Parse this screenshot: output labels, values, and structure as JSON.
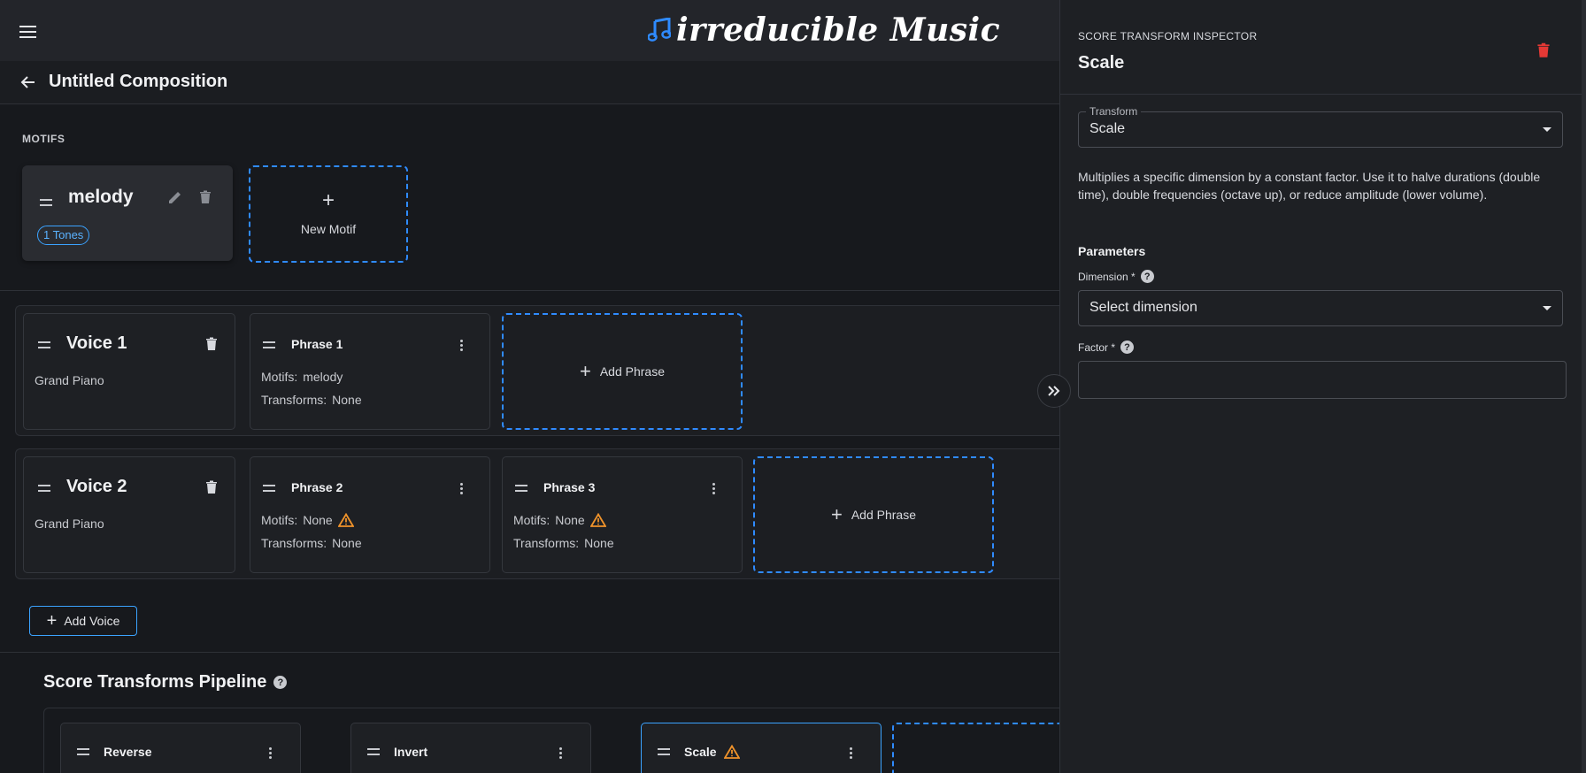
{
  "app": {
    "brand_name": "irreducible Music"
  },
  "header": {
    "composition_title": "Untitled Composition"
  },
  "motifs": {
    "section_label": "MOTIFS",
    "items": [
      {
        "name": "melody",
        "badge": "1 Tones"
      }
    ],
    "new_label": "New Motif"
  },
  "voices": [
    {
      "title": "Voice 1",
      "instrument": "Grand Piano",
      "phrases": [
        {
          "title": "Phrase 1",
          "motifs_label": "Motifs:",
          "motifs_value": "melody",
          "transforms_label": "Transforms:",
          "transforms_value": "None",
          "warning": false
        }
      ]
    },
    {
      "title": "Voice 2",
      "instrument": "Grand Piano",
      "phrases": [
        {
          "title": "Phrase 2",
          "motifs_label": "Motifs:",
          "motifs_value": "None",
          "transforms_label": "Transforms:",
          "transforms_value": "None",
          "warning": true
        },
        {
          "title": "Phrase 3",
          "motifs_label": "Motifs:",
          "motifs_value": "None",
          "transforms_label": "Transforms:",
          "transforms_value": "None",
          "warning": true
        }
      ]
    }
  ],
  "add_phrase_label": "Add Phrase",
  "add_voice_label": "Add Voice",
  "pipeline": {
    "title": "Score Transforms Pipeline",
    "help_glyph": "?",
    "items": [
      {
        "title": "Reverse",
        "warning": false,
        "active": false
      },
      {
        "title": "Invert",
        "warning": false,
        "active": false
      },
      {
        "title": "Scale",
        "warning": true,
        "active": true
      }
    ]
  },
  "inspector": {
    "kicker": "SCORE TRANSFORM INSPECTOR",
    "title": "Scale",
    "transform_legend": "Transform",
    "transform_value": "Scale",
    "description": "Multiplies a specific dimension by a constant factor. Use it to halve durations (double time), double frequencies (octave up), or reduce amplitude (lower volume).",
    "params_title": "Parameters",
    "dimension_label": "Dimension *",
    "dimension_placeholder": "Select dimension",
    "factor_label": "Factor *",
    "factor_value": "",
    "help_glyph": "?"
  },
  "colors": {
    "accent": "#3ba3ff",
    "danger": "#e53935",
    "warning": "#f0932b",
    "background": "#17191d",
    "surface": "#1e2024"
  }
}
